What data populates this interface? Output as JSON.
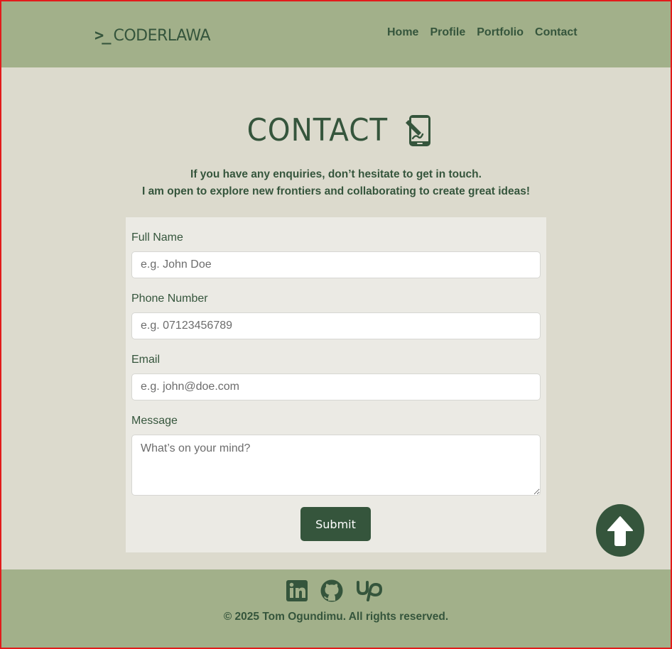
{
  "brand": {
    "prompt_symbol": ">_",
    "name": "CODERLAWA"
  },
  "nav": {
    "items": [
      "Home",
      "Profile",
      "Portfolio",
      "Contact"
    ]
  },
  "contact": {
    "title": "CONTACT",
    "intro_line1": "If you have any enquiries, don’t hesitate to get in touch.",
    "intro_line2": "I am open to explore new frontiers and collaborating to create great ideas!"
  },
  "form": {
    "full_name": {
      "label": "Full Name",
      "placeholder": "e.g. John Doe"
    },
    "phone": {
      "label": "Phone Number",
      "placeholder": "e.g. 07123456789"
    },
    "email": {
      "label": "Email",
      "placeholder": "e.g. john@doe.com"
    },
    "message": {
      "label": "Message",
      "placeholder": "What’s on your mind?"
    },
    "submit_label": "Submit"
  },
  "footer": {
    "socials": [
      "linkedin-icon",
      "github-icon",
      "upwork-icon"
    ],
    "copyright": "© 2025 Tom Ogundimu. All rights reserved."
  },
  "colors": {
    "header_footer_bg": "#a2b08a",
    "page_bg": "#dcdacd",
    "accent_dark_green": "#35553c",
    "form_bg": "#ebeae4"
  }
}
